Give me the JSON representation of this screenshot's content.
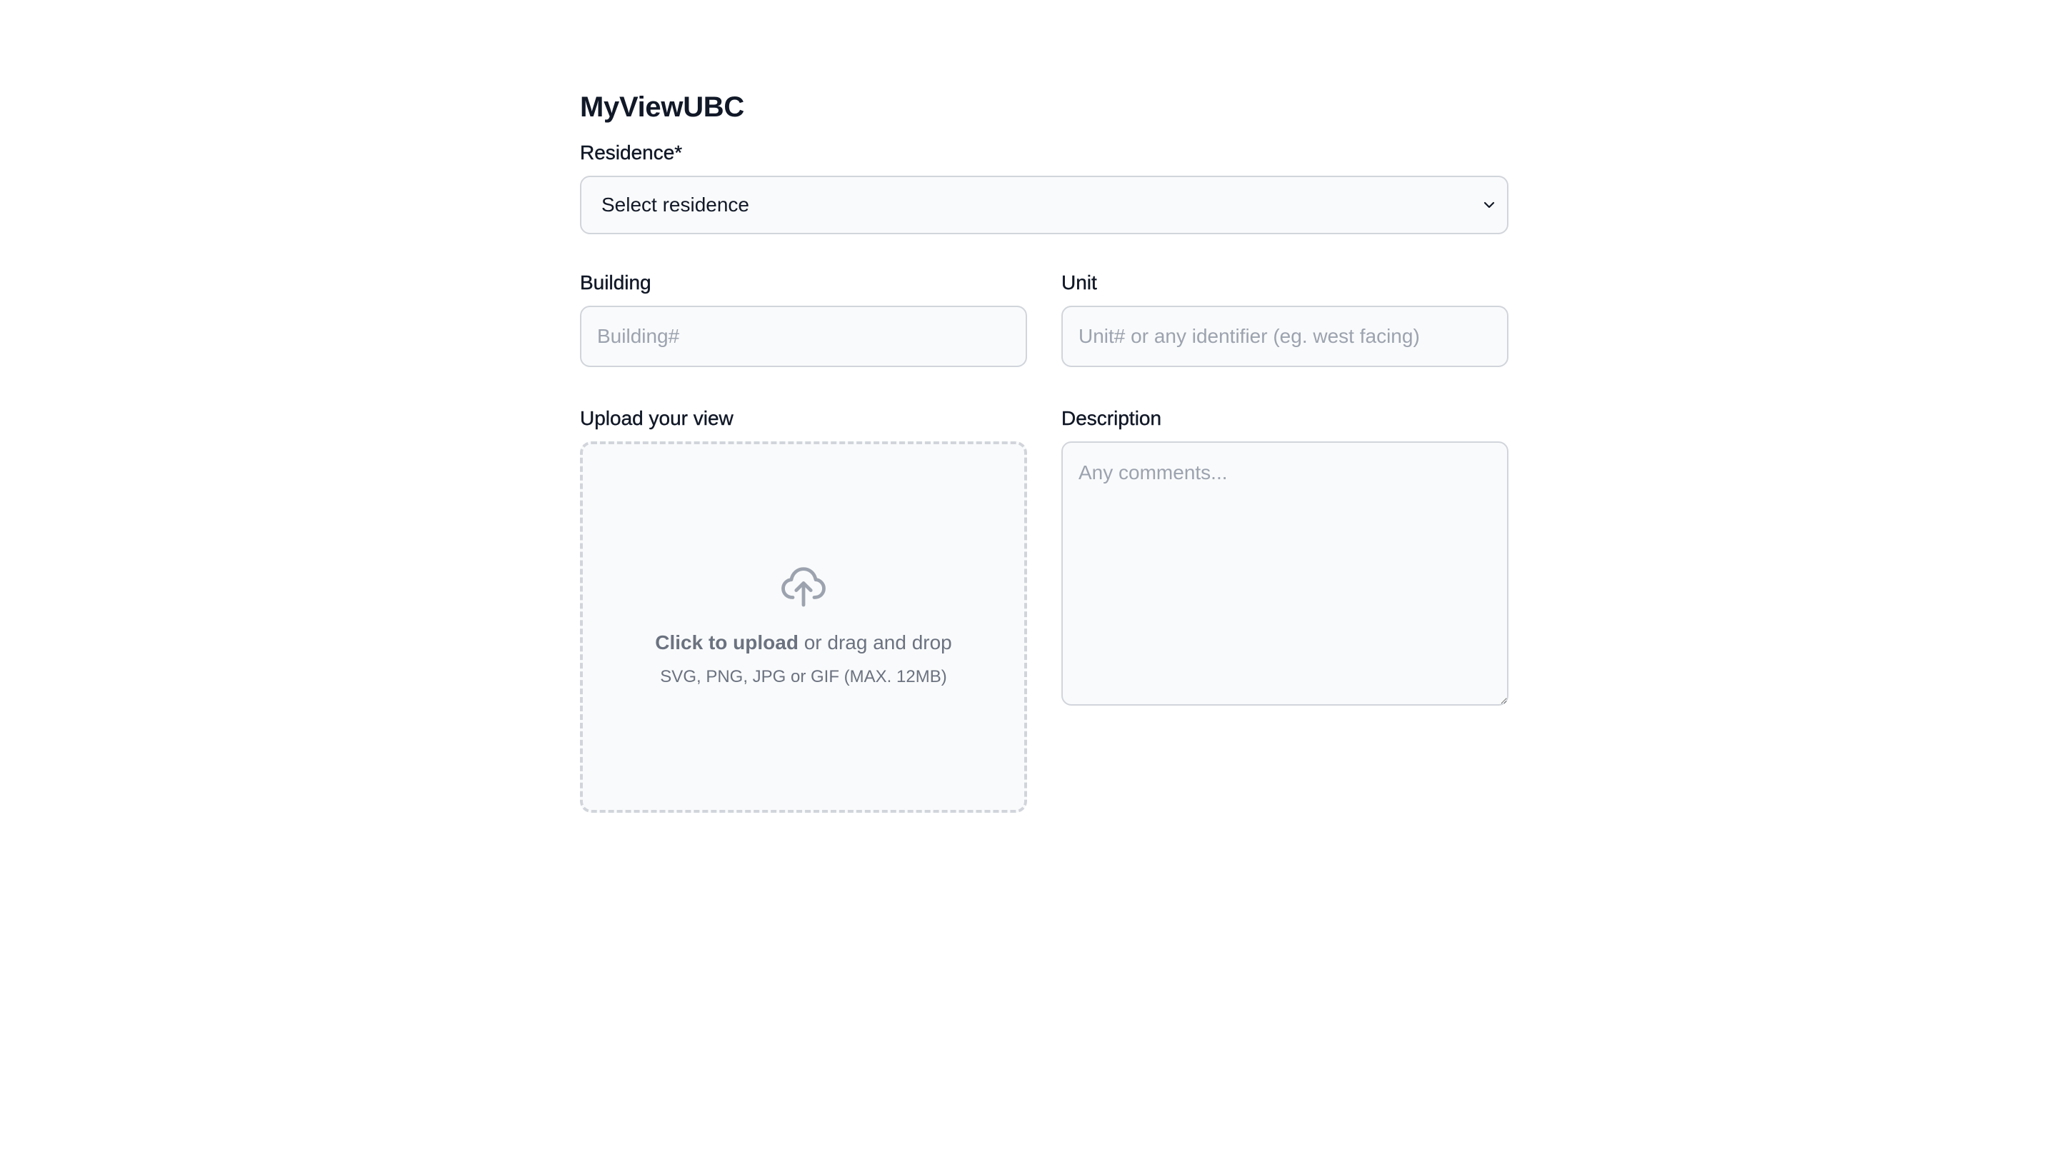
{
  "app": {
    "title": "MyViewUBC"
  },
  "residence": {
    "label": "Residence*",
    "selected_value": "Select residence"
  },
  "building": {
    "label": "Building",
    "placeholder": "Building#"
  },
  "unit": {
    "label": "Unit",
    "placeholder": "Unit# or any identifier (eg. west facing)"
  },
  "upload": {
    "label": "Upload your view",
    "click_text": "Click to upload",
    "drag_text": " or drag and drop",
    "formats_text": "SVG, PNG, JPG or GIF (MAX. 12MB)",
    "icon": "cloud-upload-icon"
  },
  "description": {
    "label": "Description",
    "placeholder": "Any comments..."
  },
  "colors": {
    "field_background": "#f9fafb",
    "field_border": "#d1d5db",
    "placeholder_text": "#9ca3af",
    "muted_text": "#6b7280",
    "primary_text": "#111827"
  }
}
